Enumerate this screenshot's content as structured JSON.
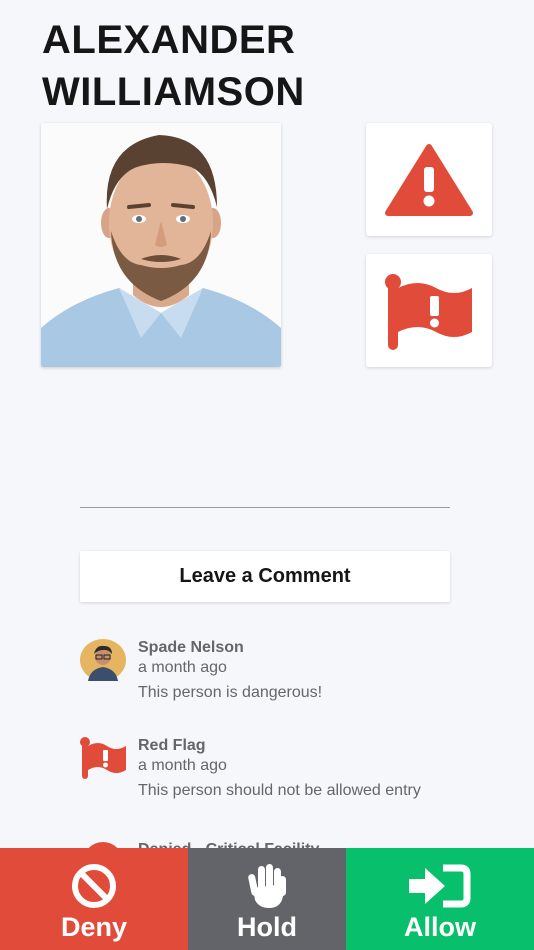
{
  "person": {
    "first_name": "ALEXANDER",
    "last_name": "WILLIAMSON"
  },
  "alerts": {
    "warning_icon": "warning-triangle-icon",
    "flag_icon": "red-flag-icon",
    "color": "#e14c3a"
  },
  "comment_button": {
    "label": "Leave a Comment"
  },
  "comments": [
    {
      "author": "Spade Nelson",
      "time": "a month ago",
      "text": "This person is dangerous!",
      "avatar": "user-avatar"
    },
    {
      "author": "Red Flag",
      "time": "a month ago",
      "text": "This person should not be allowed entry",
      "avatar": "red-flag-icon"
    },
    {
      "author": "Denied - Critical Facility",
      "time": "",
      "text": "",
      "avatar": "deny-icon"
    }
  ],
  "actions": {
    "deny": {
      "label": "Deny",
      "color": "#e14c3a",
      "icon": "ban-icon"
    },
    "hold": {
      "label": "Hold",
      "color": "#636469",
      "icon": "hand-icon"
    },
    "allow": {
      "label": "Allow",
      "color": "#08c06c",
      "icon": "sign-in-icon"
    }
  }
}
